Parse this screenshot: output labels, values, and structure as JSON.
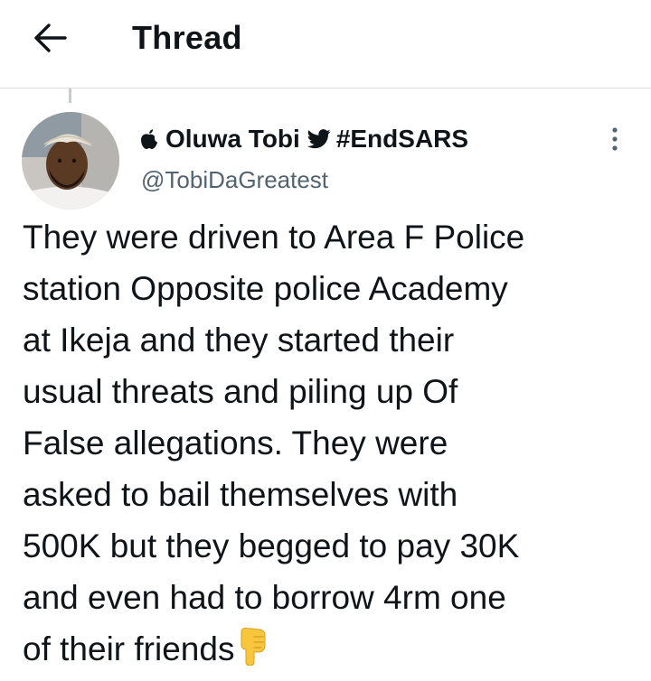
{
  "header": {
    "title": "Thread",
    "back_icon": "arrow-left-icon"
  },
  "tweet": {
    "author": {
      "name": "Oluwa Tobi",
      "name_prefix_icon": "apple-icon",
      "name_mid_icon": "twitter-bird-icon",
      "hashtag": "#EndSARS",
      "handle": "@TobiDaGreatest",
      "avatar_icon": "profile-avatar"
    },
    "more_icon": "more-vertical-icon",
    "text_lines": [
      "They were driven to Area F Police",
      "station Opposite police Academy",
      "at Ikeja and they started their",
      "usual threats and piling up Of",
      "False allegations. They were",
      "asked to bail themselves with",
      "500K but they begged to pay 30K",
      "and even had to borrow 4rm one",
      "of their friends"
    ],
    "end_emoji": "pointing-down-hand-emoji"
  },
  "colors": {
    "text_primary": "#0f1419",
    "text_secondary": "#536471",
    "divider": "#dcdfe2",
    "emoji_yellow": "#f7c63c"
  }
}
